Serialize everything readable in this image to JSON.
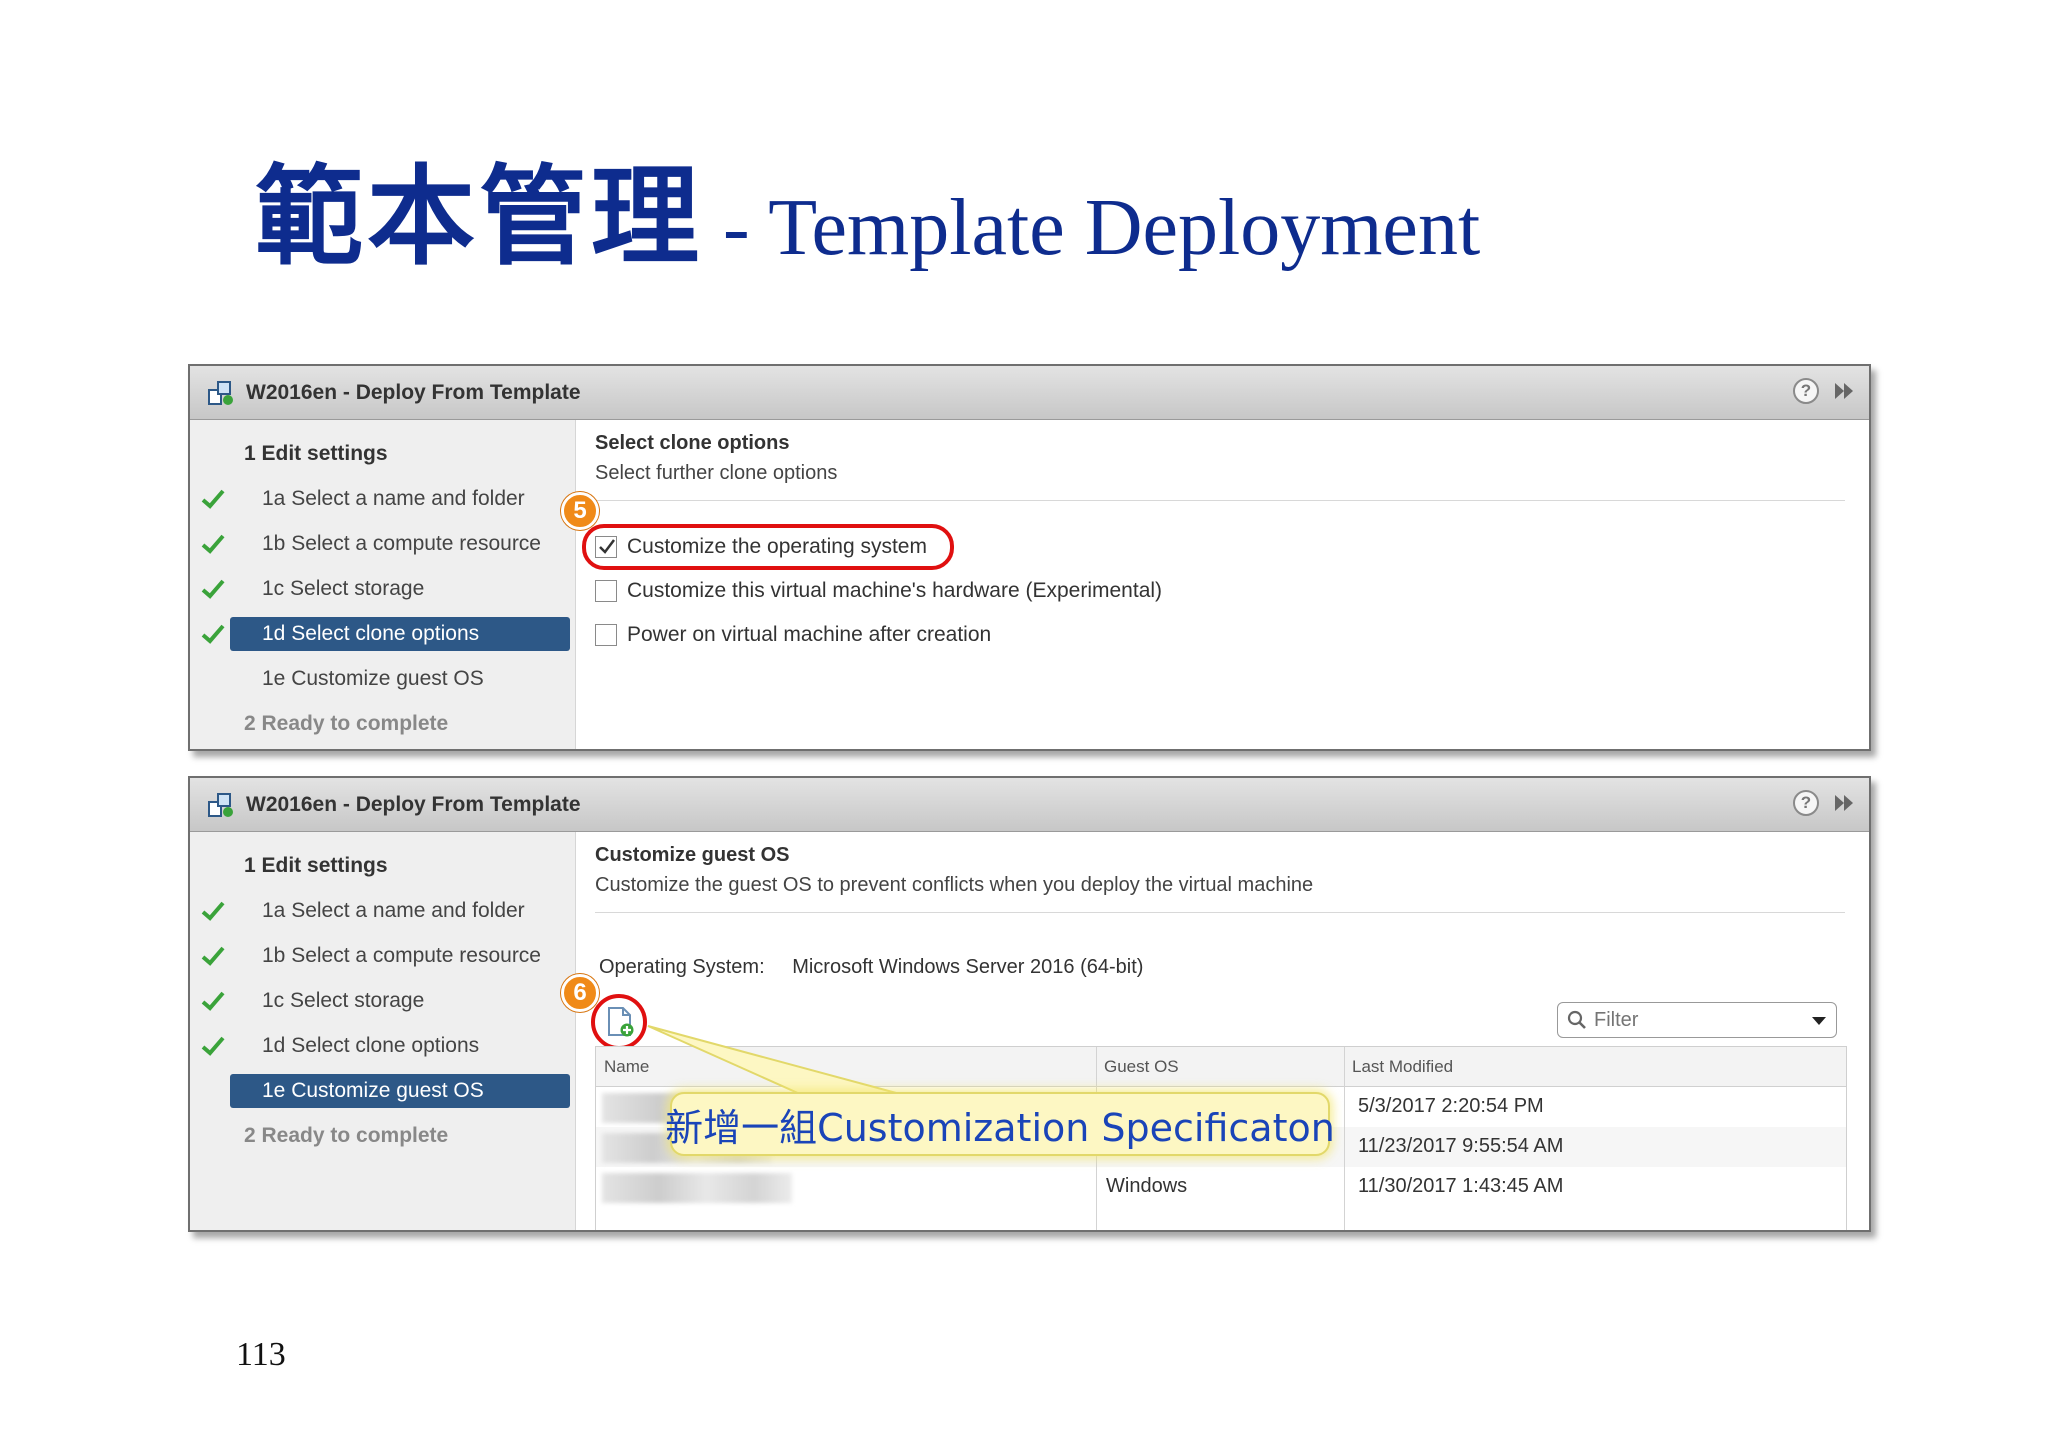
{
  "slide": {
    "title_cn": "範本管理",
    "title_en": "- Template Deployment",
    "page_number": "113",
    "title_color": "#0e2c8e"
  },
  "wizard1": {
    "window_title": "W2016en - Deploy From Template",
    "nav": [
      {
        "label": "1  Edit settings",
        "type": "header",
        "checked": false
      },
      {
        "label": "1a  Select a name and folder",
        "type": "sub",
        "checked": true
      },
      {
        "label": "1b  Select a compute resource",
        "type": "sub",
        "checked": true
      },
      {
        "label": "1c  Select storage",
        "type": "sub",
        "checked": true
      },
      {
        "label": "1d  Select clone options",
        "type": "sub",
        "checked": true,
        "selected": true
      },
      {
        "label": "1e  Customize guest OS",
        "type": "sub",
        "checked": false
      },
      {
        "label": "2  Ready to complete",
        "type": "disabled",
        "checked": false
      }
    ],
    "heading": "Select clone options",
    "subheading": "Select further clone options",
    "options": [
      {
        "label": "Customize the operating system",
        "checked": true
      },
      {
        "label": "Customize this virtual machine's hardware (Experimental)",
        "checked": false
      },
      {
        "label": "Power on virtual machine after creation",
        "checked": false
      }
    ],
    "step_badge": "5"
  },
  "wizard2": {
    "window_title": "W2016en - Deploy From Template",
    "nav": [
      {
        "label": "1  Edit settings",
        "type": "header",
        "checked": false
      },
      {
        "label": "1a  Select a name and folder",
        "type": "sub",
        "checked": true
      },
      {
        "label": "1b  Select a compute resource",
        "type": "sub",
        "checked": true
      },
      {
        "label": "1c  Select storage",
        "type": "sub",
        "checked": true
      },
      {
        "label": "1d  Select clone options",
        "type": "sub",
        "checked": true
      },
      {
        "label": "1e  Customize guest OS",
        "type": "sub",
        "checked": false,
        "selected": true
      },
      {
        "label": "2  Ready to complete",
        "type": "disabled",
        "checked": false
      }
    ],
    "heading": "Customize guest OS",
    "subheading": "Customize the guest OS to prevent conflicts when you deploy the virtual machine",
    "os_label": "Operating System:",
    "os_value": "Microsoft Windows Server 2016 (64-bit)",
    "filter_placeholder": "Filter",
    "step_badge": "6",
    "table": {
      "columns": [
        "Name",
        "Guest OS",
        "Last Modified"
      ],
      "rows": [
        {
          "name": "",
          "guest_os": "",
          "last_modified": "5/3/2017 2:20:54 PM"
        },
        {
          "name": "",
          "guest_os": "",
          "last_modified": "11/23/2017 9:55:54 AM"
        },
        {
          "name": "",
          "guest_os": "Windows",
          "last_modified": "11/30/2017 1:43:45 AM"
        }
      ]
    },
    "callout": "新增一組Customization Specificaton"
  },
  "colors": {
    "nav_selected": "#2d5887",
    "check_green": "#3aa33a",
    "highlight_red": "#e01010",
    "badge_orange": "#f08a18",
    "callout_bg": "#fdf7c3",
    "callout_text": "#1a44b8"
  }
}
